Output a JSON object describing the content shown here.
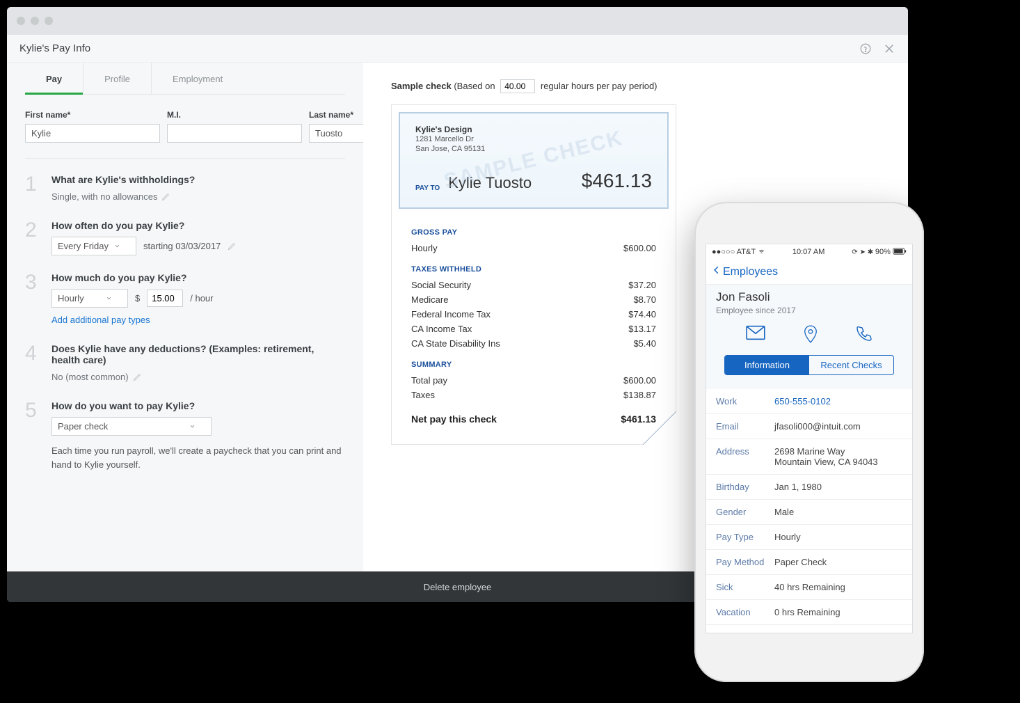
{
  "header": {
    "title": "Kylie's Pay Info"
  },
  "tabs": {
    "pay": "Pay",
    "profile": "Profile",
    "employment": "Employment"
  },
  "name": {
    "first_label": "First name*",
    "mi_label": "M.I.",
    "last_label": "Last name*",
    "first": "Kylie",
    "mi": "",
    "last": "Tuosto"
  },
  "steps": {
    "s1": {
      "num": "1",
      "q": "What are Kylie's withholdings?",
      "a": "Single, with no allowances"
    },
    "s2": {
      "num": "2",
      "q": "How often do you pay Kylie?",
      "select": "Every Friday",
      "starting": "starting 03/03/2017"
    },
    "s3": {
      "num": "3",
      "q": "How much do you pay Kylie?",
      "select": "Hourly",
      "currency": "$",
      "rate": "15.00",
      "per": "/ hour",
      "link": "Add additional pay types"
    },
    "s4": {
      "num": "4",
      "q": "Does Kylie have any deductions? (Examples: retirement, health care)",
      "a": "No (most common)"
    },
    "s5": {
      "num": "5",
      "q": "How do you want to pay Kylie?",
      "select": "Paper check",
      "note": "Each time you run payroll, we'll create a paycheck that you can print and hand to Kylie yourself."
    }
  },
  "sample": {
    "label_prefix": "Sample check",
    "based_on_prefix": "(Based on",
    "hours": "40.00",
    "based_on_suffix": "regular hours per pay period)",
    "company_name": "Kylie's Design",
    "company_addr1": "1281 Marcello Dr",
    "company_addr2": "San Jose, CA 95131",
    "watermark": "SAMPLE CHECK",
    "payto_label": "PAY TO",
    "payee": "Kylie Tuosto",
    "amount": "$461.13",
    "gross_title": "GROSS PAY",
    "gross_items": [
      {
        "label": "Hourly",
        "value": "$600.00"
      }
    ],
    "tax_title": "TAXES WITHHELD",
    "tax_items": [
      {
        "label": "Social Security",
        "value": "$37.20"
      },
      {
        "label": "Medicare",
        "value": "$8.70"
      },
      {
        "label": "Federal Income Tax",
        "value": "$74.40"
      },
      {
        "label": "CA Income Tax",
        "value": "$13.17"
      },
      {
        "label": "CA State Disability Ins",
        "value": "$5.40"
      }
    ],
    "summary_title": "SUMMARY",
    "summary_items": [
      {
        "label": "Total pay",
        "value": "$600.00"
      },
      {
        "label": "Taxes",
        "value": "$138.87"
      }
    ],
    "net_label": "Net pay this check",
    "net_value": "$461.13"
  },
  "footer": {
    "delete": "Delete employee"
  },
  "phone": {
    "status": {
      "carrier": "●●○○○ AT&T",
      "time": "10:07 AM",
      "battery": "90%"
    },
    "back": "Employees",
    "emp_name": "Jon Fasoli",
    "emp_sub": "Employee since 2017",
    "seg_info": "Information",
    "seg_checks": "Recent Checks",
    "rows": [
      {
        "key": "Work",
        "val": "650-555-0102",
        "link": true
      },
      {
        "key": "Email",
        "val": "jfasoli000@intuit.com",
        "link": false
      },
      {
        "key": "Address",
        "val": "2698 Marine Way\nMountain View, CA 94043",
        "link": false
      },
      {
        "key": "Birthday",
        "val": "Jan 1, 1980",
        "link": false
      },
      {
        "key": "Gender",
        "val": "Male",
        "link": false
      },
      {
        "key": "Pay Type",
        "val": "Hourly",
        "link": false
      },
      {
        "key": "Pay Method",
        "val": "Paper Check",
        "link": false
      },
      {
        "key": "Sick",
        "val": "40 hrs Remaining",
        "link": false
      },
      {
        "key": "Vacation",
        "val": "0 hrs Remaining",
        "link": false
      }
    ]
  }
}
